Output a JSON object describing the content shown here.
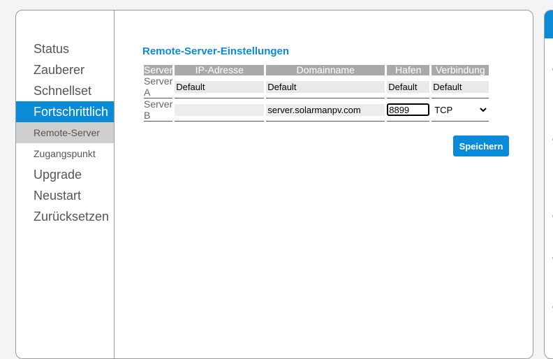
{
  "nav": {
    "items": [
      {
        "label": "Status",
        "active": false,
        "sub": false
      },
      {
        "label": "Zauberer",
        "active": false,
        "sub": false
      },
      {
        "label": "Schnellset",
        "active": false,
        "sub": false
      },
      {
        "label": "Fortschrittlich",
        "active": true,
        "sub": false
      },
      {
        "label": "Remote-Server",
        "active": false,
        "sub": true,
        "selected": true
      },
      {
        "label": "Zugangspunkt",
        "active": false,
        "sub": true
      },
      {
        "label": "Upgrade",
        "active": false,
        "sub": false
      },
      {
        "label": "Neustart",
        "active": false,
        "sub": false
      },
      {
        "label": "Zurücksetzen",
        "active": false,
        "sub": false
      }
    ]
  },
  "section": {
    "title": "Remote-Server-Einstellungen",
    "headers": [
      "Server",
      "IP-Adresse",
      "Domainname",
      "Hafen",
      "Verbindung"
    ],
    "rows": [
      {
        "server": "Server A",
        "ip": "Default",
        "domain": "Default",
        "port": "Default",
        "connection": "Default"
      },
      {
        "server": "Server B",
        "ip": "",
        "domain": "server.solarmanpv.com",
        "port": "8899",
        "connection": "TCP"
      }
    ],
    "save_label": "Speichern"
  },
  "colors": {
    "accent": "#0b8ad8",
    "header_bg": "#a9a9a9"
  }
}
